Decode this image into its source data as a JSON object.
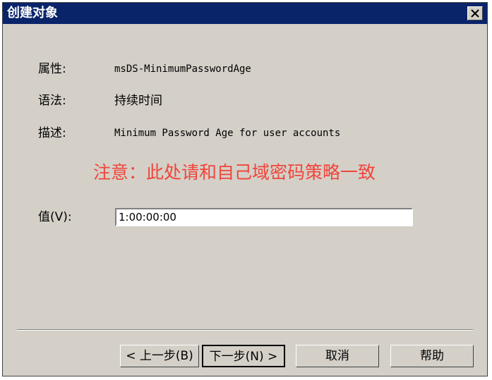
{
  "window": {
    "title": "创建对象"
  },
  "fields": {
    "attribute_label": "属性:",
    "attribute_value": "msDS-MinimumPasswordAge",
    "syntax_label": "语法:",
    "syntax_value": "持续时间",
    "description_label": "描述:",
    "description_value": "Minimum Password Age for user accounts"
  },
  "notice": {
    "text": "注意：此处请和自己域密码策略一致",
    "color": "#f0453a"
  },
  "value_field": {
    "label": "值(V):",
    "value": "1:00:00:00"
  },
  "buttons": {
    "back": "< 上一步(B)",
    "next": "下一步(N) >",
    "cancel": "取消",
    "help": "帮助"
  },
  "colors": {
    "titlebar": "#0a246a",
    "dialog_bg": "#d4d0c8"
  }
}
